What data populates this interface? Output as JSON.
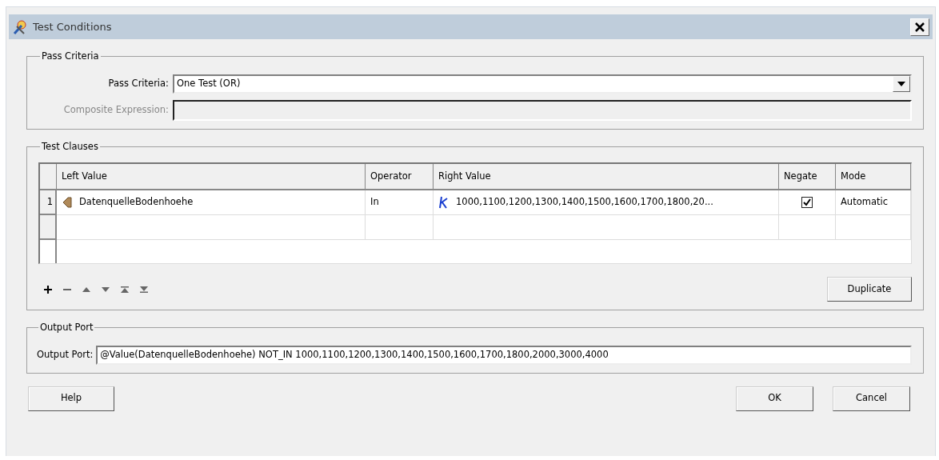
{
  "window": {
    "title": "Test Conditions"
  },
  "pass_criteria": {
    "legend": "Pass Criteria",
    "label": "Pass Criteria:",
    "value": "One Test (OR)",
    "composite_label": "Composite Expression:",
    "composite_disabled": true
  },
  "test_clauses": {
    "legend": "Test Clauses",
    "columns": [
      "Left Value",
      "Operator",
      "Right Value",
      "Negate",
      "Mode"
    ],
    "rows": [
      {
        "number": "1",
        "left_value": "DatenquelleBodenhoehe",
        "operator": "In",
        "right_value": "1000,1100,1200,1300,1400,1500,1600,1700,1800,20...",
        "negate": true,
        "mode": "Automatic"
      }
    ],
    "duplicate_button": "Duplicate"
  },
  "output_port": {
    "legend": "Output Port",
    "label": "Output Port:",
    "value": "@Value(DatenquelleBodenhoehe) NOT_IN 1000,1100,1200,1300,1400,1500,1600,1700,1800,2000,3000,4000"
  },
  "buttons": {
    "help": "Help",
    "ok": "OK",
    "cancel": "Cancel"
  }
}
